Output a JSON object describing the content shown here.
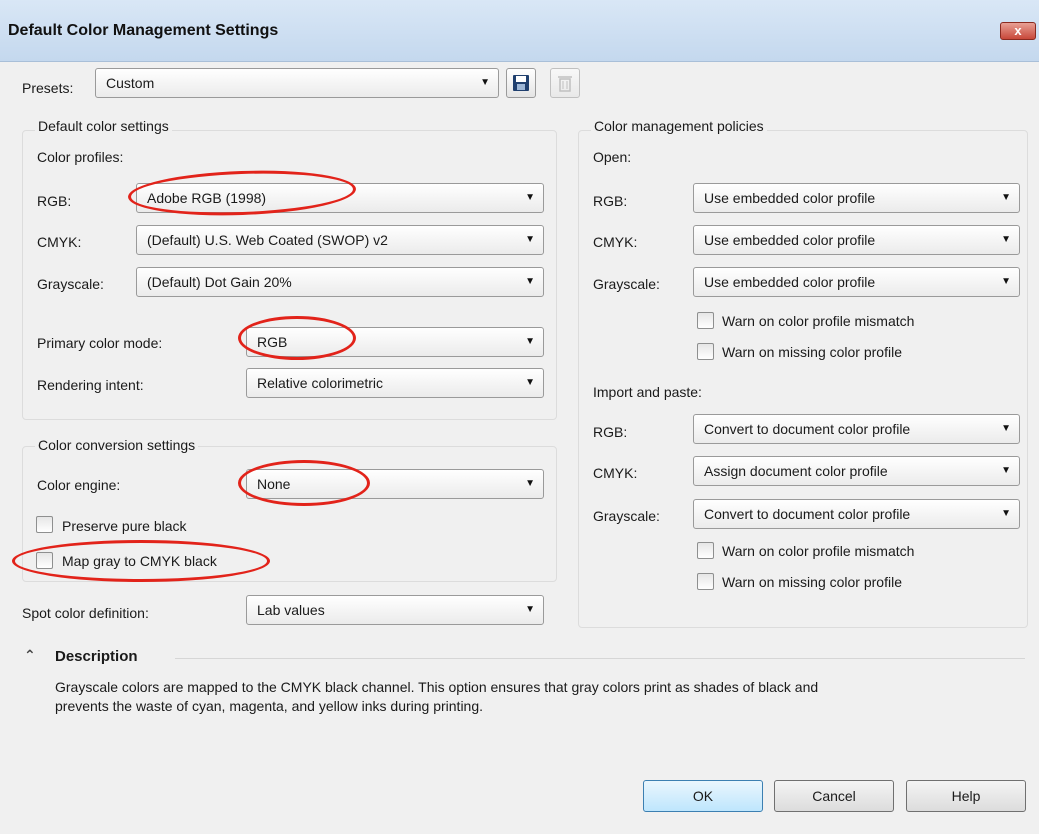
{
  "window": {
    "title": "Default Color Management Settings",
    "close_glyph": "x"
  },
  "presets": {
    "label": "Presets:",
    "value": "Custom",
    "save_icon": "save-icon",
    "delete_icon": "trash-icon"
  },
  "default_color_settings": {
    "title": "Default color settings",
    "profiles_label": "Color profiles:",
    "rgb": {
      "label": "RGB:",
      "value": "Adobe RGB (1998)"
    },
    "cmyk": {
      "label": "CMYK:",
      "value": "(Default) U.S. Web Coated (SWOP) v2"
    },
    "grayscale": {
      "label": "Grayscale:",
      "value": "(Default) Dot Gain 20%"
    },
    "primary_mode": {
      "label": "Primary color mode:",
      "value": "RGB"
    },
    "rendering_intent": {
      "label": "Rendering intent:",
      "value": "Relative colorimetric"
    }
  },
  "conversion": {
    "title": "Color conversion settings",
    "engine": {
      "label": "Color engine:",
      "value": "None"
    },
    "preserve_black": {
      "label": "Preserve pure black",
      "checked": false
    },
    "map_gray": {
      "label": "Map gray to CMYK black",
      "checked": false
    }
  },
  "spot": {
    "label": "Spot color definition:",
    "value": "Lab values"
  },
  "policies": {
    "title": "Color management policies",
    "open": {
      "label": "Open:",
      "rgb": {
        "label": "RGB:",
        "value": "Use embedded color profile"
      },
      "cmyk": {
        "label": "CMYK:",
        "value": "Use embedded color profile"
      },
      "grayscale": {
        "label": "Grayscale:",
        "value": "Use embedded color profile"
      },
      "warn_mismatch": "Warn on color profile mismatch",
      "warn_missing": "Warn on missing color profile"
    },
    "import": {
      "label": "Import and paste:",
      "rgb": {
        "label": "RGB:",
        "value": "Convert to document color profile"
      },
      "cmyk": {
        "label": "CMYK:",
        "value": "Assign document color profile"
      },
      "grayscale": {
        "label": "Grayscale:",
        "value": "Convert to document color profile"
      },
      "warn_mismatch": "Warn on color profile mismatch",
      "warn_missing": "Warn on missing color profile"
    }
  },
  "description": {
    "title": "Description",
    "collapse_icon": "double-chevron-up-icon",
    "line1": "Grayscale colors are mapped to the CMYK black channel. This option ensures that gray colors print as shades of black and",
    "line2": "prevents the waste of cyan, magenta, and yellow inks during printing."
  },
  "buttons": {
    "ok": "OK",
    "cancel": "Cancel",
    "help": "Help"
  },
  "dropdown_arrow": "▼",
  "colors": {
    "annotation": "#e2231a",
    "title_bar": "#c4d8ee"
  }
}
